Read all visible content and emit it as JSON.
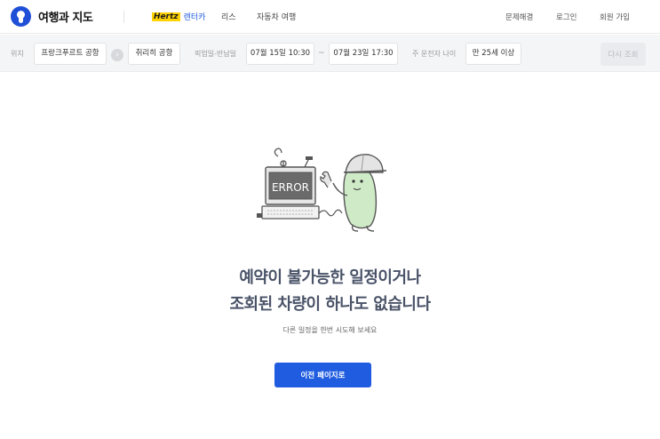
{
  "header": {
    "logo_text": "여행과 지도",
    "nav": {
      "hertz": "Hertz",
      "rentcar": "렌터카",
      "lease": "리스",
      "car_trip": "자동차 여행"
    },
    "right": {
      "help": "문제해결",
      "login": "로그인",
      "signup": "회원 가입"
    }
  },
  "search": {
    "location_label": "위치",
    "pickup_location": "프랑크푸르트 공항",
    "dropoff_location": "취리히 공항",
    "dates_label": "픽업일-반납일",
    "pickup_date": "07월 15일 10:30",
    "date_separator": "~",
    "return_date": "07월 23일 17:30",
    "driver_age_label": "주 운전자 나이",
    "driver_age": "만 25세 이상",
    "research_button": "다시 조회"
  },
  "error": {
    "illustration_text": "ERROR",
    "headline_line1": "예약이 불가능한 일정이거나",
    "headline_line2": "조회된 차량이 하나도 없습니다",
    "subtext": "다른 일정을 한번 시도해 보세요",
    "back_button": "이전 페이지로"
  },
  "colors": {
    "brand": "#1f4fd6",
    "primary_button": "#1f5ce0",
    "headline": "#4a5368",
    "hertz_yellow": "#ffd200"
  }
}
